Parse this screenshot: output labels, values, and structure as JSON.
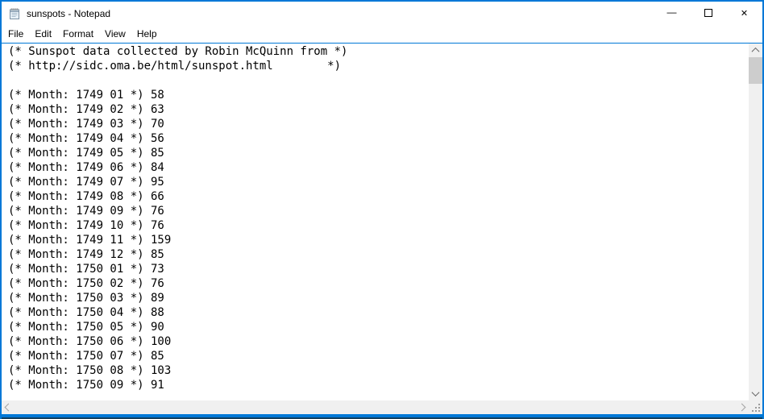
{
  "window": {
    "title": "sunspots - Notepad",
    "accent_color": "#0078d7"
  },
  "titlebar": {
    "app_icon": "notepad-icon",
    "minimize_glyph": "—",
    "maximize_glyph": "❐",
    "close_glyph": "✕"
  },
  "menu": {
    "items": [
      {
        "label": "File"
      },
      {
        "label": "Edit"
      },
      {
        "label": "Format"
      },
      {
        "label": "View"
      },
      {
        "label": "Help"
      }
    ]
  },
  "editor": {
    "lines": [
      "(* Sunspot data collected by Robin McQuinn from *)",
      "(* http://sidc.oma.be/html/sunspot.html        *)",
      "",
      "(* Month: 1749 01 *) 58",
      "(* Month: 1749 02 *) 63",
      "(* Month: 1749 03 *) 70",
      "(* Month: 1749 04 *) 56",
      "(* Month: 1749 05 *) 85",
      "(* Month: 1749 06 *) 84",
      "(* Month: 1749 07 *) 95",
      "(* Month: 1749 08 *) 66",
      "(* Month: 1749 09 *) 76",
      "(* Month: 1749 10 *) 76",
      "(* Month: 1749 11 *) 159",
      "(* Month: 1749 12 *) 85",
      "(* Month: 1750 01 *) 73",
      "(* Month: 1750 02 *) 76",
      "(* Month: 1750 03 *) 89",
      "(* Month: 1750 04 *) 88",
      "(* Month: 1750 05 *) 90",
      "(* Month: 1750 06 *) 100",
      "(* Month: 1750 07 *) 85",
      "(* Month: 1750 08 *) 103",
      "(* Month: 1750 09 *) 91"
    ]
  },
  "sunspot_series": {
    "months": [
      "1749-01",
      "1749-02",
      "1749-03",
      "1749-04",
      "1749-05",
      "1749-06",
      "1749-07",
      "1749-08",
      "1749-09",
      "1749-10",
      "1749-11",
      "1749-12",
      "1750-01",
      "1750-02",
      "1750-03",
      "1750-04",
      "1750-05",
      "1750-06",
      "1750-07",
      "1750-08",
      "1750-09"
    ],
    "values": [
      58,
      63,
      70,
      56,
      85,
      84,
      95,
      66,
      76,
      76,
      159,
      85,
      73,
      76,
      89,
      88,
      90,
      100,
      85,
      103,
      91
    ]
  },
  "scrollbars": {
    "vertical": {
      "thumb_visible": true,
      "thumb_position": "top"
    },
    "horizontal": {
      "thumb_visible": false
    }
  }
}
